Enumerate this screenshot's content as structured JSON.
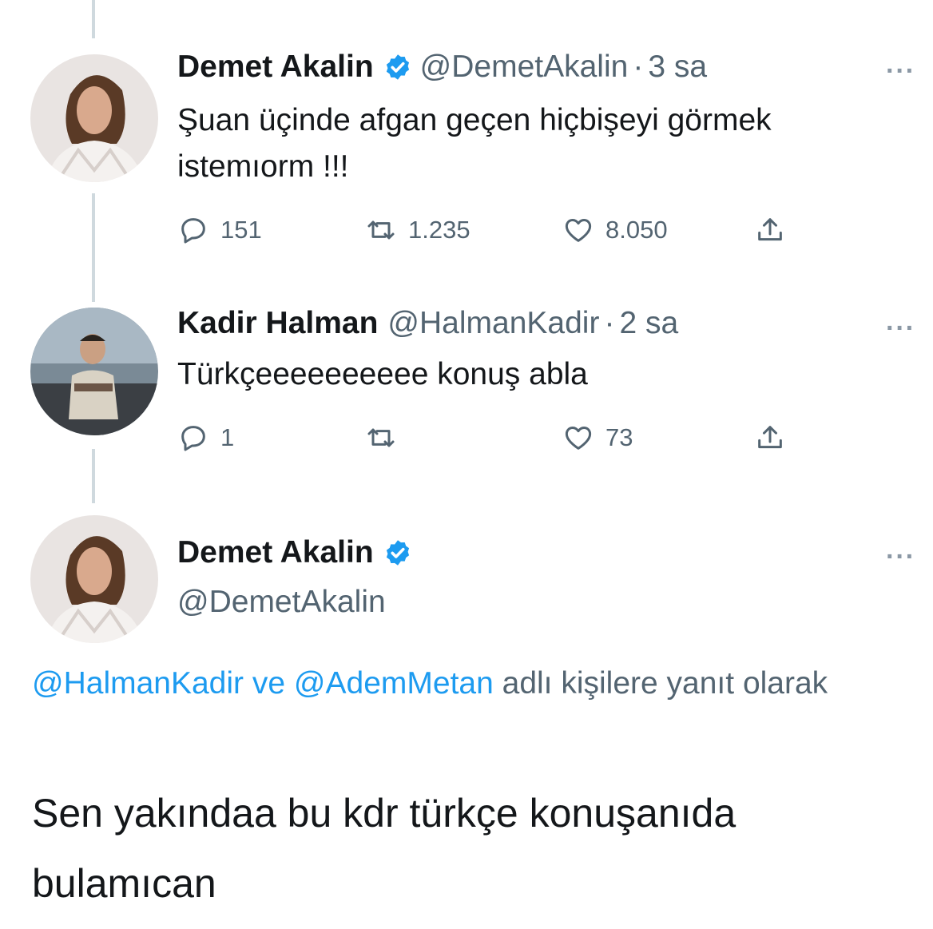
{
  "tweets": [
    {
      "name": "Demet Akalin",
      "verified": true,
      "handle": "@DemetAkalin",
      "separator": "·",
      "time": "3 sa",
      "more": "···",
      "text": "Şuan üçinde afgan geçen hiçbişeyi görmek istemıorm !!!",
      "replies": "151",
      "retweets": "1.235",
      "likes": "8.050"
    },
    {
      "name": "Kadir Halman",
      "verified": false,
      "handle": "@HalmanKadir",
      "separator": "·",
      "time": "2 sa",
      "more": "···",
      "text": "Türkçeeeeeeeeee konuş abla",
      "replies": "1",
      "retweets": "",
      "likes": "73"
    }
  ],
  "focused": {
    "name": "Demet Akalin",
    "verified": true,
    "handle": "@DemetAkalin",
    "more": "···",
    "reply_mention_1": "@HalmanKadir",
    "reply_connector": "ve",
    "reply_mention_2": "@AdemMetan",
    "reply_suffix": "adlı kişilere yanıt olarak",
    "text": "Sen yakındaa bu kdr türkçe konuşanıda bulamıcan"
  },
  "colors": {
    "accent": "#1d9bf0",
    "muted": "#536471",
    "text": "#14171a",
    "thread_line": "#cfd9de"
  },
  "icons": [
    "reply-icon",
    "retweet-icon",
    "like-icon",
    "share-icon",
    "verified-badge-icon",
    "more-icon"
  ]
}
